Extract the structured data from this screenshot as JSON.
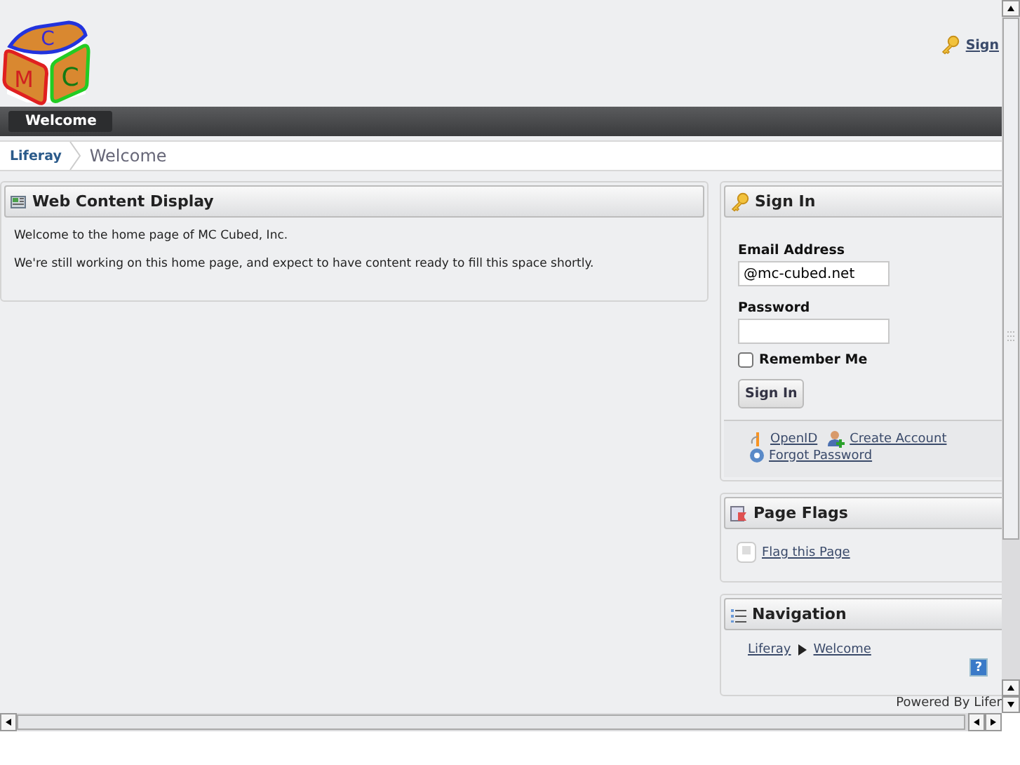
{
  "header": {
    "logo_letters": [
      "C",
      "M",
      "C"
    ],
    "sign_in_link": "Sign"
  },
  "nav": {
    "tabs": [
      {
        "label": "Welcome",
        "selected": true
      }
    ]
  },
  "breadcrumb": [
    "Liferay",
    "Welcome"
  ],
  "web_content": {
    "title": "Web Content Display",
    "paragraphs": [
      "Welcome to the home page of MC Cubed, Inc.",
      "We're still working on this home page, and expect to have content ready to fill this space shortly."
    ]
  },
  "sign_in": {
    "title": "Sign In",
    "email_label": "Email Address",
    "email_value": "@mc-cubed.net",
    "password_label": "Password",
    "remember_me": {
      "label": "Remember Me",
      "checked": false
    },
    "button": "Sign In",
    "links": [
      {
        "kind": "openid",
        "label": "OpenID"
      },
      {
        "kind": "account",
        "label": "Create Account"
      },
      {
        "kind": "help",
        "label": "Forgot Password"
      }
    ]
  },
  "page_flags": {
    "title": "Page Flags",
    "link": "Flag this Page"
  },
  "navigation": {
    "title": "Navigation",
    "links": [
      "Liferay",
      "Welcome"
    ],
    "help": "?"
  },
  "footer": {
    "powered_by": "Powered By Lifer"
  }
}
